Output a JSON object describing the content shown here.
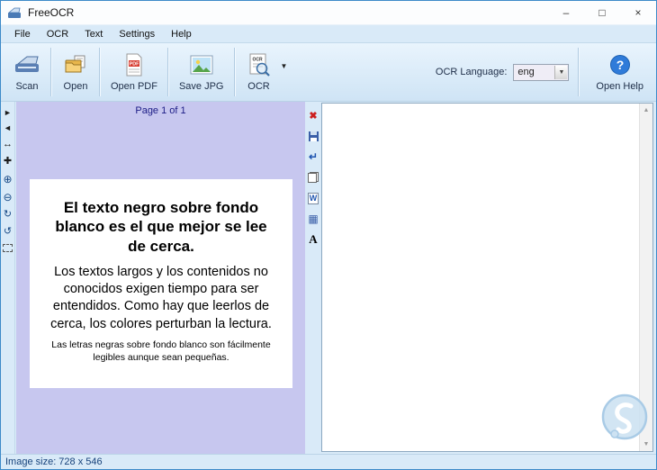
{
  "window": {
    "title": "FreeOCR"
  },
  "titlebar": {
    "minimize": "–",
    "maximize": "□",
    "close": "×"
  },
  "menu": {
    "items": [
      {
        "label": "File"
      },
      {
        "label": "OCR"
      },
      {
        "label": "Text"
      },
      {
        "label": "Settings"
      },
      {
        "label": "Help"
      }
    ]
  },
  "toolbar": {
    "buttons": [
      {
        "label": "Scan",
        "icon": "scanner-icon"
      },
      {
        "label": "Open",
        "icon": "folder-open-icon"
      },
      {
        "label": "Open PDF",
        "icon": "pdf-document-icon"
      },
      {
        "label": "Save JPG",
        "icon": "picture-icon"
      },
      {
        "label": "OCR",
        "icon": "ocr-magnifier-icon"
      }
    ],
    "pdf_icon_text": "PDF",
    "ocr_icon_text": "OCR",
    "help_icon_glyph": "?",
    "language_label": "OCR Language:",
    "language_value": "eng",
    "help_label": "Open Help"
  },
  "glyphs": {
    "combo_arrow": "▼",
    "ocr_dropdown": "▼",
    "scroll_up": "▲",
    "scroll_down": "▼"
  },
  "left_tools": [
    {
      "name": "nav-next-icon",
      "glyph": "►"
    },
    {
      "name": "nav-previous-icon",
      "glyph": "◄"
    },
    {
      "name": "fit-width-icon",
      "glyph": "↔"
    },
    {
      "name": "pan-move-icon",
      "glyph": "✚"
    },
    {
      "name": "zoom-in-icon",
      "glyph": "⊕"
    },
    {
      "name": "zoom-out-icon",
      "glyph": "⊖"
    },
    {
      "name": "rotate-cw-icon",
      "glyph": "↻"
    },
    {
      "name": "rotate-ccw-icon",
      "glyph": "↺"
    },
    {
      "name": "select-area-icon",
      "glyph": ""
    }
  ],
  "middle_tools": [
    {
      "name": "clear-text-icon",
      "glyph": "✖"
    },
    {
      "name": "save-text-icon",
      "glyph": ""
    },
    {
      "name": "send-to-editor-icon",
      "glyph": "↵"
    },
    {
      "name": "copy-text-icon",
      "glyph": ""
    },
    {
      "name": "export-word-icon",
      "glyph": "W"
    },
    {
      "name": "export-table-icon",
      "glyph": "▦"
    },
    {
      "name": "font-settings-icon",
      "glyph": "A"
    }
  ],
  "image_panel": {
    "page_indicator": "Page 1 of 1",
    "document": {
      "heading": "El texto negro sobre fondo blanco es el que mejor se lee de cerca.",
      "body": "Los textos largos y los contenidos no conocidos exigen tiempo para ser entendidos. Como hay que leerlos de cerca, los colores perturban la lectura.",
      "footnote": "Las letras negras sobre fondo blanco son fácilmente legibles aunque sean pequeñas."
    }
  },
  "statusbar": {
    "text": "Image size: 728 x 546"
  },
  "colors": {
    "accent_blue": "#2f7bd9",
    "toolbar_blue": "#d9eaf8",
    "panel_lavender": "#c7c7ef"
  }
}
